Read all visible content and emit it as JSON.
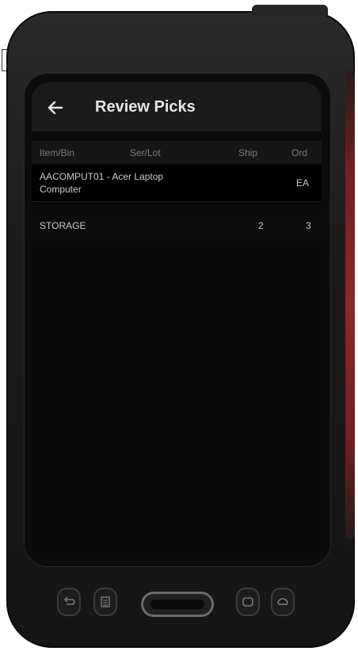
{
  "app": {
    "title": "Review Picks"
  },
  "table": {
    "headers": {
      "item": "Item/Bin",
      "serlot": "Ser/Lot",
      "ship": "Ship",
      "ord": "Ord"
    },
    "rows": [
      {
        "item_line1": "AACOMPUT01 - Acer Laptop",
        "item_line2": "Computer",
        "serlot": "",
        "ship": "",
        "ord": "EA"
      },
      {
        "bin": "STORAGE",
        "serlot": "",
        "ship": "2",
        "ord": "3"
      }
    ]
  },
  "icons": {
    "back": "arrow-left-icon",
    "nav": [
      "back-key-icon",
      "menu-key-icon",
      "home-key-icon",
      "recent-key-icon"
    ]
  },
  "colors": {
    "appbar": "#1b1b1b",
    "background": "#0a0a0a",
    "device_accent": "#8a2a24"
  }
}
